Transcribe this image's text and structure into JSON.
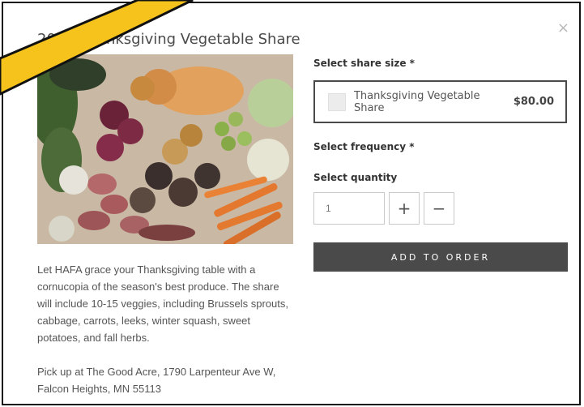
{
  "modal": {
    "title": "2021 Thanksgiving Vegetable Share",
    "close_icon": "×",
    "photo": {
      "icon": "vegetable-photo"
    },
    "description": [
      "Let HAFA grace your Thanksgiving table with a cornucopia of the season's best produce. The share will include 10-15 veggies, including Brussels sprouts, cabbage, carrots, leeks, winter squash, sweet potatoes, and fall herbs.",
      "Pick up at The Good Acre, 1790 Larpenteur Ave W, Falcon Heights, MN 55113"
    ]
  },
  "form": {
    "share_size_label": "Select share size *",
    "share_option": {
      "name": "Thanksgiving Vegetable Share",
      "price": "$80.00"
    },
    "frequency_label": "Select frequency *",
    "quantity_label": "Select quantity",
    "quantity_value": "1",
    "plus": "+",
    "minus": "−",
    "add_button": "ADD TO ORDER"
  },
  "colors": {
    "ribbon_fill": "#f5c31c",
    "button_bg": "#4a4a4a"
  }
}
